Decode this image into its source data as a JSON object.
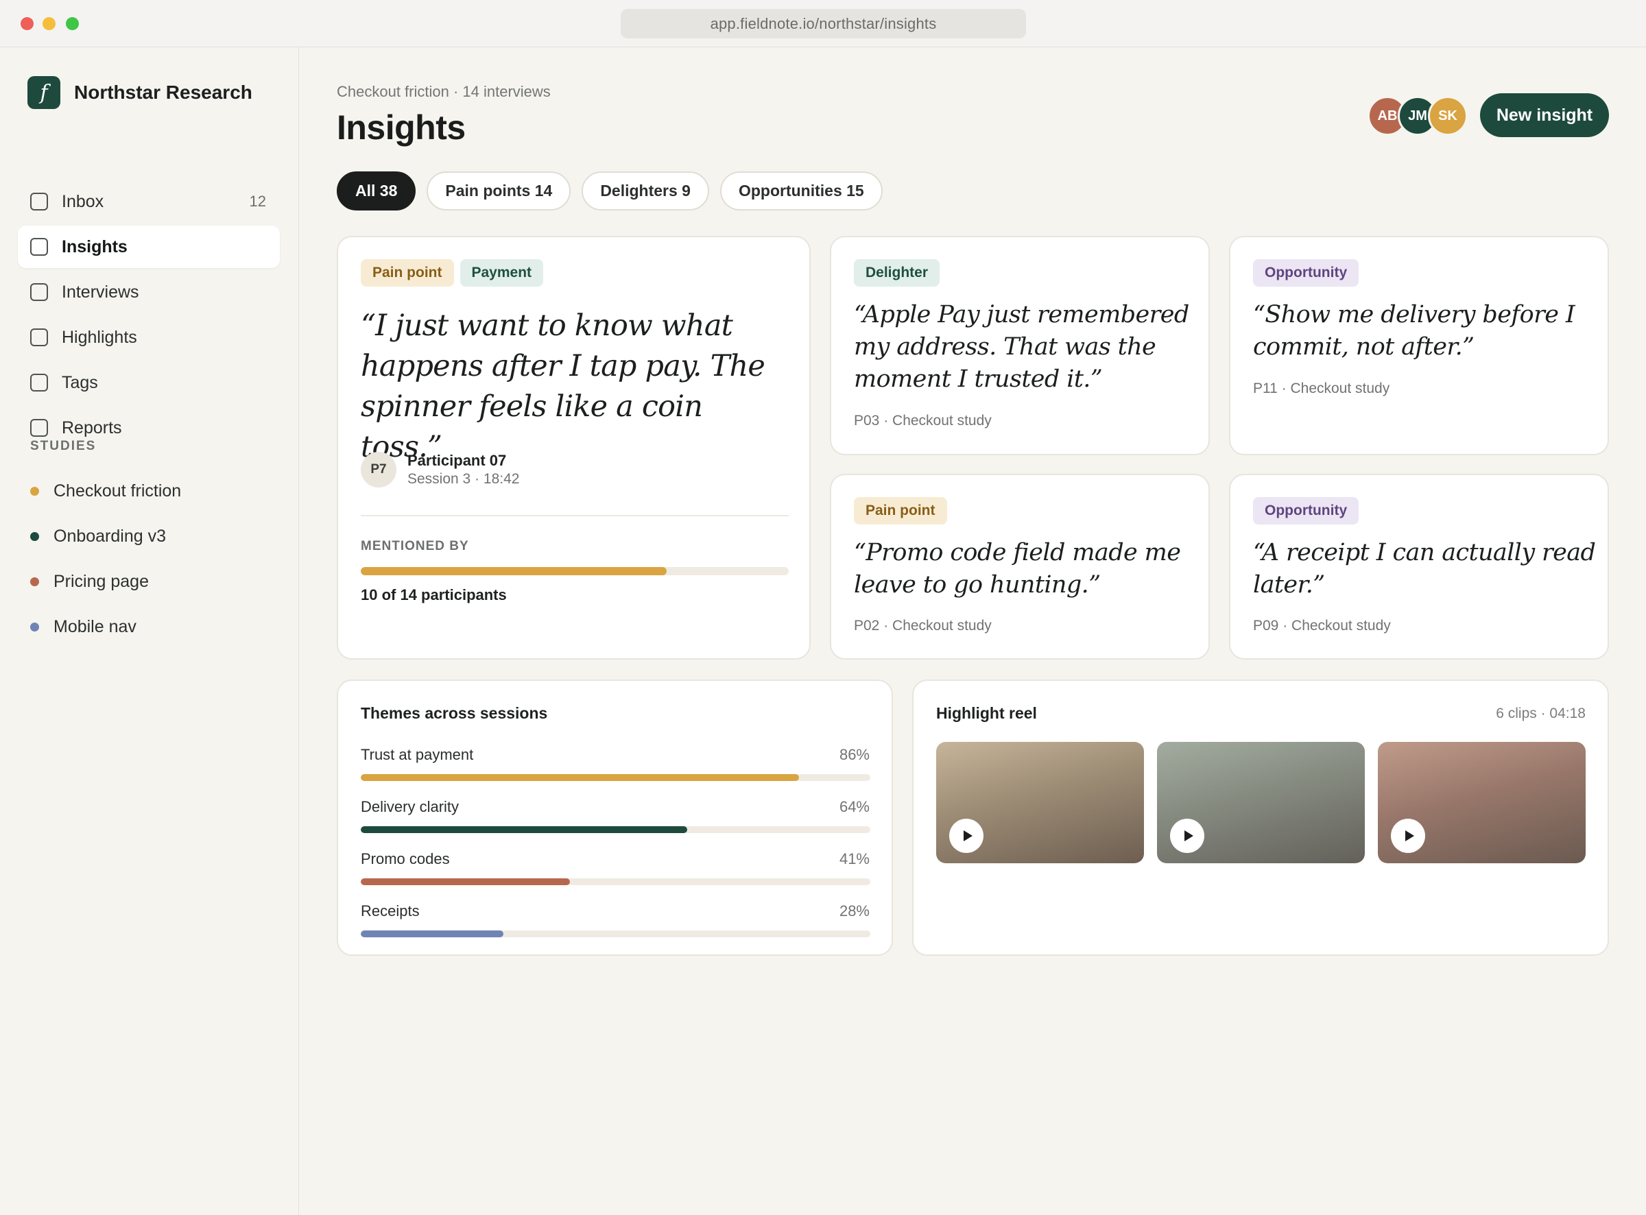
{
  "window": {
    "url": "app.fieldnote.io/northstar/insights"
  },
  "sidebar": {
    "brand_logo": "f",
    "brand_name": "Northstar Research",
    "nav": [
      {
        "label": "Inbox",
        "count": "12"
      },
      {
        "label": "Insights",
        "count": ""
      },
      {
        "label": "Interviews",
        "count": ""
      },
      {
        "label": "Highlights",
        "count": ""
      },
      {
        "label": "Tags",
        "count": ""
      },
      {
        "label": "Reports",
        "count": ""
      }
    ],
    "active_item": "Insights",
    "studies_heading": "STUDIES",
    "studies": [
      {
        "label": "Checkout friction",
        "color": "#d9a441"
      },
      {
        "label": "Onboarding v3",
        "color": "#1d4a3d"
      },
      {
        "label": "Pricing page",
        "color": "#b8674f"
      },
      {
        "label": "Mobile nav",
        "color": "#6f84b5"
      }
    ]
  },
  "header": {
    "breadcrumb": "Checkout friction · 14 interviews",
    "title": "Insights",
    "avatars": [
      {
        "initials": "AB",
        "color": "#b8674f"
      },
      {
        "initials": "JM",
        "color": "#1d4a3d"
      },
      {
        "initials": "SK",
        "color": "#d9a441"
      }
    ],
    "new_button": "New insight"
  },
  "filters": [
    {
      "label": "All 38",
      "active": true
    },
    {
      "label": "Pain points 14",
      "active": false
    },
    {
      "label": "Delighters 9",
      "active": false
    },
    {
      "label": "Opportunities 15",
      "active": false
    }
  ],
  "featured": {
    "tags": [
      "Pain point",
      "Payment"
    ],
    "quote": "“I just want to know what happens after I tap pay. The spinner feels like a coin toss.”",
    "participant_initials": "P7",
    "participant_name": "Participant 07",
    "participant_session": "Session 3 · 18:42",
    "mentioned_label": "MENTIONED BY",
    "mentioned_fraction": 0.714,
    "mentioned_text": "10 of 14 participants"
  },
  "cards": [
    {
      "tag": "Delighter",
      "quote": "“Apple Pay just remembered my address. That was the moment I trusted it.”",
      "meta": "P03 · Checkout study"
    },
    {
      "tag": "Opportunity",
      "quote": "“Show me delivery before I commit, not after.”",
      "meta": "P11 · Checkout study"
    },
    {
      "tag": "Pain point",
      "quote": "“Promo code field made me leave to go hunting.”",
      "meta": "P02 · Checkout study"
    },
    {
      "tag": "Opportunity",
      "quote": "“A receipt I can actually read later.”",
      "meta": "P09 · Checkout study"
    }
  ],
  "themes": {
    "title": "Themes across sessions",
    "items": [
      {
        "label": "Trust at payment",
        "pct": "86%",
        "value": 0.86,
        "color": "#d9a441"
      },
      {
        "label": "Delivery clarity",
        "pct": "64%",
        "value": 0.64,
        "color": "#1d4a3d"
      },
      {
        "label": "Promo codes",
        "pct": "41%",
        "value": 0.41,
        "color": "#b8674f"
      },
      {
        "label": "Receipts",
        "pct": "28%",
        "value": 0.28,
        "color": "#6f84b5"
      }
    ]
  },
  "reel": {
    "title": "Highlight reel",
    "meta": "6 clips · 04:18"
  }
}
